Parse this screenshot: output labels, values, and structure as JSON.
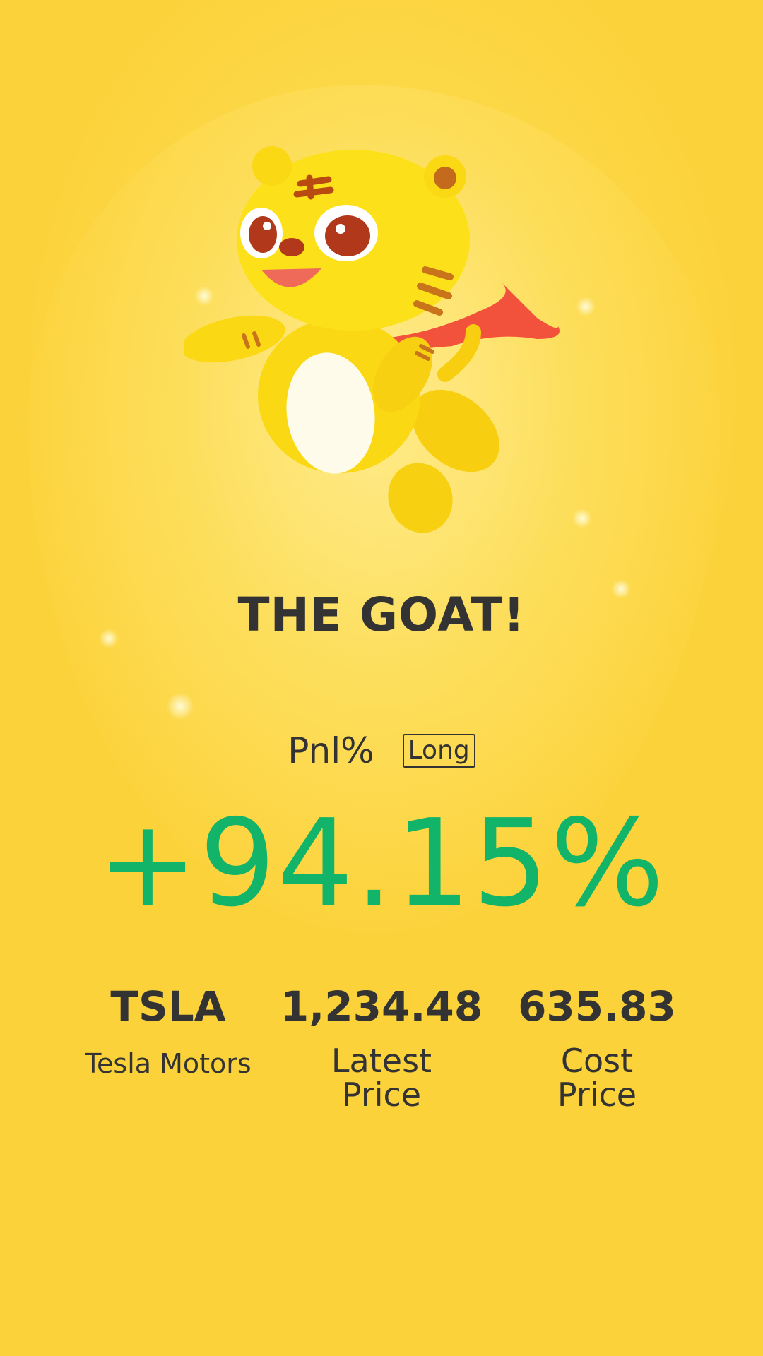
{
  "headline": "THE GOAT!",
  "pnl": {
    "label": "Pnl%",
    "position_tag": "Long",
    "value": "+94.15%",
    "value_color": "#12b46a"
  },
  "stats": [
    {
      "value": "TSLA",
      "label": "Tesla Motors"
    },
    {
      "value": "1,234.48",
      "label_line1": "Latest",
      "label_line2": "Price"
    },
    {
      "value": "635.83",
      "label_line1": "Cost",
      "label_line2": "Price"
    }
  ],
  "mascot": {
    "icon": "tiger-mascot-icon"
  },
  "colors": {
    "background": "#fcd94a",
    "text": "#333333",
    "gain": "#12b46a"
  }
}
